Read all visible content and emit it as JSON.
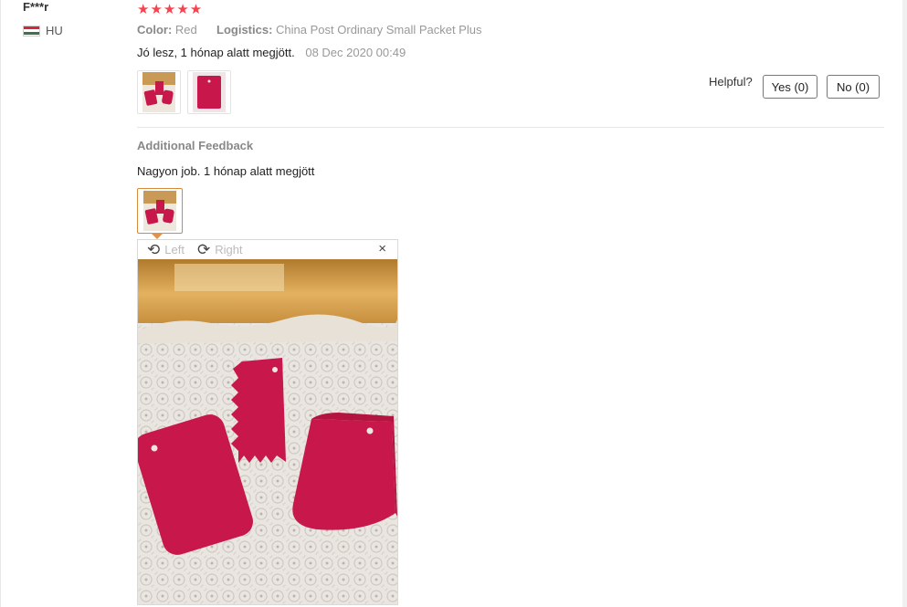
{
  "reviewer": {
    "name": "F***r",
    "country": "HU"
  },
  "rating": {
    "stars": 5,
    "star_glyphs": "★★★★★"
  },
  "attributes": {
    "color_label": "Color:",
    "color_value": "Red",
    "logistics_label": "Logistics:",
    "logistics_value": "China Post Ordinary Small Packet Plus"
  },
  "review": {
    "text": "Jó lesz, 1 hónap alatt megjött.",
    "date": "08 Dec 2020 00:49"
  },
  "helpful": {
    "label": "Helpful?",
    "yes": "Yes (0)",
    "no": "No (0)"
  },
  "additional": {
    "heading": "Additional Feedback",
    "text": "Nagyon job. 1 hónap alatt megjött"
  },
  "viewer": {
    "rotate_left": "Left",
    "rotate_right": "Right",
    "close_glyph": "×"
  },
  "colors": {
    "star": "#f6434f",
    "product": "#c8174a",
    "selected_border": "#d58a3a"
  }
}
